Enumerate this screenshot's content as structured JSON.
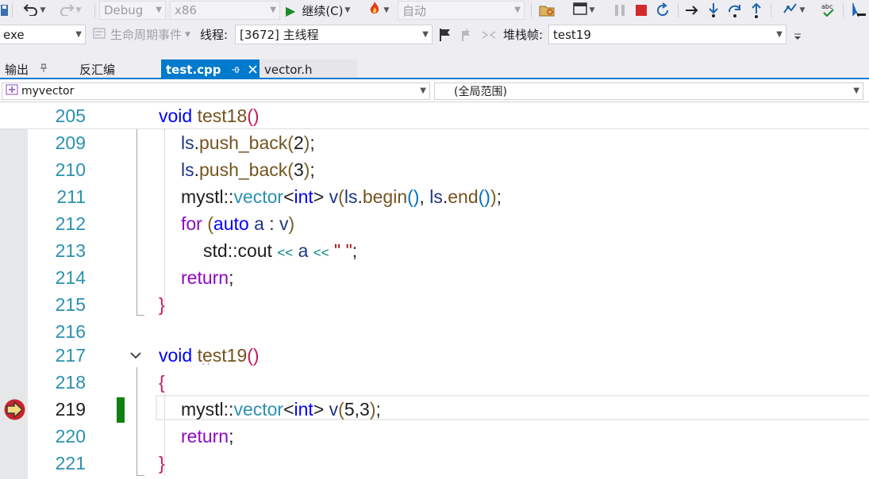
{
  "toolbar": {
    "config": "Debug",
    "platform": "x86",
    "continue_label": "继续(C)",
    "auto_label": "自动"
  },
  "toolbar2": {
    "process_tail": "exe",
    "lifecycle_label": "生命周期事件",
    "thread_label": "线程:",
    "thread_value": "[3672] 主线程",
    "stackframe_label": "堆栈帧:",
    "stackframe_value": "test19"
  },
  "tabs": {
    "output": "输出",
    "disassembly": "反汇编",
    "active": "test.cpp",
    "vector": "vector.h"
  },
  "nav": {
    "scope": "myvector",
    "global": "(全局范围)"
  },
  "editor": {
    "sticky_line": "205",
    "lines": [
      "209",
      "210",
      "211",
      "212",
      "213",
      "214",
      "215",
      "216",
      "217",
      "218",
      "219",
      "220",
      "221"
    ],
    "current_line": "219"
  },
  "code": {
    "void": "void",
    "test18": "test18",
    "test19": "test19",
    "ls": "ls",
    "push_back": "push_back",
    "mystl": "mystl",
    "vector": "vector",
    "int": "int",
    "v": "v",
    "begin": "begin",
    "end": "end",
    "for": "for",
    "auto": "auto",
    "a": "a",
    "std": "std",
    "cout": "cout",
    "return": "return",
    "str_space": "\" \"",
    "n2": "2",
    "n3": "3",
    "n5": "5"
  },
  "icons": {
    "undo": "undo-icon",
    "redo": "redo-icon",
    "continue": "play-icon",
    "hot-reload": "flame-icon",
    "stop": "stop-icon",
    "restart": "restart-icon",
    "step-over": "step-over-icon",
    "step-into": "step-into-icon",
    "step-out": "step-out-icon",
    "exec-pointer": "current-statement-arrow-icon"
  },
  "colors": {
    "accent": "#007acc",
    "keyword": "#0000ff",
    "control_keyword": "#8f08c4",
    "function": "#74531f",
    "type": "#2b91af",
    "line_number": "#2b91af",
    "change_bar": "#108010"
  }
}
